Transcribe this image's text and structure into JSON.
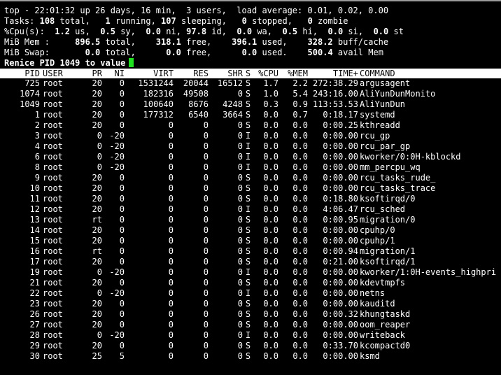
{
  "summary": {
    "uptime": "top - 22:01:32 up 26 days, 16 min,  3 users,  load average: 0.01, 0.02, 0.00",
    "tasks_label": "Tasks:",
    "tasks_total": "108",
    "tasks_total_label": " total,",
    "tasks_running": "1",
    "tasks_running_label": " running,",
    "tasks_sleeping": "107",
    "tasks_sleeping_label": " sleeping,",
    "tasks_stopped": "0",
    "tasks_stopped_label": " stopped,",
    "tasks_zombie": "0",
    "tasks_zombie_label": " zombie",
    "cpu_label": "%Cpu(s):",
    "cpu_us": "1.2",
    "cpu_sy": "0.5",
    "cpu_ni": "0.0",
    "cpu_id": "97.8",
    "cpu_wa": "0.0",
    "cpu_hi": "0.5",
    "cpu_si": "0.0",
    "cpu_st": "0.0",
    "mem_label": "MiB Mem :",
    "mem_total": "896.5",
    "mem_free": "318.1",
    "mem_used": "396.1",
    "mem_buff": "328.2",
    "swap_label": "MiB Swap:",
    "swap_total": "0.0",
    "swap_free": "0.0",
    "swap_used": "0.0",
    "swap_avail": "500.4"
  },
  "prompt": {
    "text": "Renice PID 1049 to value"
  },
  "columns": [
    "PID",
    "USER",
    "PR",
    "NI",
    "VIRT",
    "RES",
    "SHR",
    "S",
    "%CPU",
    "%MEM",
    "TIME+",
    "COMMAND"
  ],
  "processes": [
    [
      "725",
      "root",
      "20",
      "0",
      "1531244",
      "20044",
      "16512",
      "S",
      "1.7",
      "2.2",
      "272:38.29",
      "argusagent"
    ],
    [
      "1074",
      "root",
      "20",
      "0",
      "182316",
      "49508",
      "0",
      "S",
      "1.0",
      "5.4",
      "243:16.00",
      "AliYunDunMonito"
    ],
    [
      "1049",
      "root",
      "20",
      "0",
      "100640",
      "8676",
      "4248",
      "S",
      "0.3",
      "0.9",
      "113:53.53",
      "AliYunDun"
    ],
    [
      "1",
      "root",
      "20",
      "0",
      "177312",
      "6540",
      "3664",
      "S",
      "0.0",
      "0.7",
      "0:18.17",
      "systemd"
    ],
    [
      "2",
      "root",
      "20",
      "0",
      "0",
      "0",
      "0",
      "S",
      "0.0",
      "0.0",
      "0:00.25",
      "kthreadd"
    ],
    [
      "3",
      "root",
      "0",
      "-20",
      "0",
      "0",
      "0",
      "I",
      "0.0",
      "0.0",
      "0:00.00",
      "rcu_gp"
    ],
    [
      "4",
      "root",
      "0",
      "-20",
      "0",
      "0",
      "0",
      "I",
      "0.0",
      "0.0",
      "0:00.00",
      "rcu_par_gp"
    ],
    [
      "6",
      "root",
      "0",
      "-20",
      "0",
      "0",
      "0",
      "I",
      "0.0",
      "0.0",
      "0:00.00",
      "kworker/0:0H-kblockd"
    ],
    [
      "8",
      "root",
      "0",
      "-20",
      "0",
      "0",
      "0",
      "I",
      "0.0",
      "0.0",
      "0:00.00",
      "mm_percpu_wq"
    ],
    [
      "9",
      "root",
      "20",
      "0",
      "0",
      "0",
      "0",
      "S",
      "0.0",
      "0.0",
      "0:00.00",
      "rcu_tasks_rude_"
    ],
    [
      "10",
      "root",
      "20",
      "0",
      "0",
      "0",
      "0",
      "S",
      "0.0",
      "0.0",
      "0:00.00",
      "rcu_tasks_trace"
    ],
    [
      "11",
      "root",
      "20",
      "0",
      "0",
      "0",
      "0",
      "S",
      "0.0",
      "0.0",
      "0:18.80",
      "ksoftirqd/0"
    ],
    [
      "12",
      "root",
      "20",
      "0",
      "0",
      "0",
      "0",
      "I",
      "0.0",
      "0.0",
      "4:06.47",
      "rcu_sched"
    ],
    [
      "13",
      "root",
      "rt",
      "0",
      "0",
      "0",
      "0",
      "S",
      "0.0",
      "0.0",
      "0:00.95",
      "migration/0"
    ],
    [
      "14",
      "root",
      "20",
      "0",
      "0",
      "0",
      "0",
      "S",
      "0.0",
      "0.0",
      "0:00.00",
      "cpuhp/0"
    ],
    [
      "15",
      "root",
      "20",
      "0",
      "0",
      "0",
      "0",
      "S",
      "0.0",
      "0.0",
      "0:00.00",
      "cpuhp/1"
    ],
    [
      "16",
      "root",
      "rt",
      "0",
      "0",
      "0",
      "0",
      "S",
      "0.0",
      "0.0",
      "0:00.94",
      "migration/1"
    ],
    [
      "17",
      "root",
      "20",
      "0",
      "0",
      "0",
      "0",
      "S",
      "0.0",
      "0.0",
      "0:21.00",
      "ksoftirqd/1"
    ],
    [
      "19",
      "root",
      "0",
      "-20",
      "0",
      "0",
      "0",
      "I",
      "0.0",
      "0.0",
      "0:00.00",
      "kworker/1:0H-events_highpri"
    ],
    [
      "21",
      "root",
      "20",
      "0",
      "0",
      "0",
      "0",
      "S",
      "0.0",
      "0.0",
      "0:00.00",
      "kdevtmpfs"
    ],
    [
      "22",
      "root",
      "0",
      "-20",
      "0",
      "0",
      "0",
      "I",
      "0.0",
      "0.0",
      "0:00.00",
      "netns"
    ],
    [
      "23",
      "root",
      "20",
      "0",
      "0",
      "0",
      "0",
      "S",
      "0.0",
      "0.0",
      "0:00.00",
      "kauditd"
    ],
    [
      "26",
      "root",
      "20",
      "0",
      "0",
      "0",
      "0",
      "S",
      "0.0",
      "0.0",
      "0:00.32",
      "khungtaskd"
    ],
    [
      "27",
      "root",
      "20",
      "0",
      "0",
      "0",
      "0",
      "S",
      "0.0",
      "0.0",
      "0:00.00",
      "oom_reaper"
    ],
    [
      "28",
      "root",
      "0",
      "-20",
      "0",
      "0",
      "0",
      "I",
      "0.0",
      "0.0",
      "0:00.00",
      "writeback"
    ],
    [
      "29",
      "root",
      "20",
      "0",
      "0",
      "0",
      "0",
      "S",
      "0.0",
      "0.0",
      "0:33.70",
      "kcompactd0"
    ],
    [
      "30",
      "root",
      "25",
      "5",
      "0",
      "0",
      "0",
      "S",
      "0.0",
      "0.0",
      "0:00.00",
      "ksmd"
    ]
  ]
}
